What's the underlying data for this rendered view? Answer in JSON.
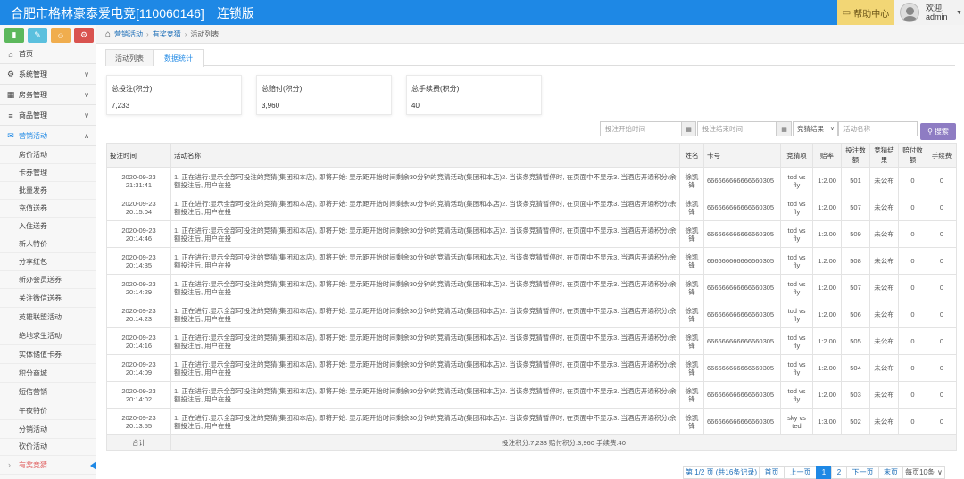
{
  "header": {
    "title": "合肥市格林豪泰爱电竞[110060146]",
    "edition": "连锁版",
    "help": "帮助中心",
    "welcome": "欢迎,",
    "user": "admin"
  },
  "toolbar": {
    "buttons": [
      {
        "icon": "signal-icon",
        "color": "#5cb85c"
      },
      {
        "icon": "pencil-icon",
        "color": "#5bc0de"
      },
      {
        "icon": "users-icon",
        "color": "#f0ad4e"
      },
      {
        "icon": "cogs-icon",
        "color": "#d9534f"
      }
    ]
  },
  "sidebar": {
    "menus": [
      {
        "label": "首页",
        "icon": "home-icon"
      },
      {
        "label": "系统管理",
        "icon": "gear-icon"
      },
      {
        "label": "房务管理",
        "icon": "building-icon"
      },
      {
        "label": "商品管理",
        "icon": "database-icon"
      },
      {
        "label": "营销活动",
        "icon": "gift-icon"
      }
    ],
    "subitems": [
      "房价活动",
      "卡券管理",
      "批量发券",
      "充值送券",
      "入住送券",
      "新人特价",
      "分享红包",
      "新办会员送券",
      "关注微信送券",
      "英雄联盟活动",
      "绝地求生活动",
      "实体储值卡券",
      "积分商城",
      "短信营销",
      "午夜特价",
      "分销活动",
      "砍价活动",
      "有奖竞猜"
    ]
  },
  "breadcrumb": {
    "items": [
      "营销活动",
      "有奖竞猜",
      "活动列表"
    ]
  },
  "tabs": [
    "活动列表",
    "数据统计"
  ],
  "stats": [
    {
      "label": "总投注(积分)",
      "value": "7,233"
    },
    {
      "label": "总赔付(积分)",
      "value": "3,960"
    },
    {
      "label": "总手续费(积分)",
      "value": "40"
    }
  ],
  "filters": {
    "start_placeholder": "投注开始时间",
    "end_placeholder": "投注结束时间",
    "result_select": "竞猜结果",
    "name_placeholder": "活动名称",
    "search_label": "搜索"
  },
  "table": {
    "headers": [
      "投注时间",
      "活动名称",
      "姓名",
      "卡号",
      "竞猜项",
      "赔率",
      "投注数额",
      "竞猜结果",
      "赔付数额",
      "手续费"
    ],
    "rows": [
      {
        "date": "2020-09-23",
        "time": "21:31:41",
        "activity": "1. 正在进行:显示全部可投注的竞猜(集团和本店), 即将开始: 显示距开始时间剩余30分钟的竞猜活动(集团和本店)2. 当该条竞猜暂停时, 在页面中不显示3. 当酒店开通积分/余额投注后, 用户在投",
        "name": "徐凯锋",
        "card": "666666666666660305",
        "item": "tod vs fly",
        "odds": "1:2.00",
        "bet": "501",
        "result": "未公布",
        "payout": "0",
        "fee": "0"
      },
      {
        "date": "2020-09-23",
        "time": "20:15:04",
        "activity": "1. 正在进行:显示全部可投注的竞猜(集团和本店), 即将开始: 显示距开始时间剩余30分钟的竞猜活动(集团和本店)2. 当该条竞猜暂停时, 在页面中不显示3. 当酒店开通积分/余额投注后, 用户在投",
        "name": "徐凯锋",
        "card": "666666666666660305",
        "item": "tod vs fly",
        "odds": "1:2.00",
        "bet": "507",
        "result": "未公布",
        "payout": "0",
        "fee": "0"
      },
      {
        "date": "2020-09-23",
        "time": "20:14:46",
        "activity": "1. 正在进行:显示全部可投注的竞猜(集团和本店), 即将开始: 显示距开始时间剩余30分钟的竞猜活动(集团和本店)2. 当该条竞猜暂停时, 在页面中不显示3. 当酒店开通积分/余额投注后, 用户在投",
        "name": "徐凯锋",
        "card": "666666666666660305",
        "item": "tod vs fly",
        "odds": "1:2.00",
        "bet": "509",
        "result": "未公布",
        "payout": "0",
        "fee": "0"
      },
      {
        "date": "2020-09-23",
        "time": "20:14:35",
        "activity": "1. 正在进行:显示全部可投注的竞猜(集团和本店), 即将开始: 显示距开始时间剩余30分钟的竞猜活动(集团和本店)2. 当该条竞猜暂停时, 在页面中不显示3. 当酒店开通积分/余额投注后, 用户在投",
        "name": "徐凯锋",
        "card": "666666666666660305",
        "item": "tod vs fly",
        "odds": "1:2.00",
        "bet": "508",
        "result": "未公布",
        "payout": "0",
        "fee": "0"
      },
      {
        "date": "2020-09-23",
        "time": "20:14:29",
        "activity": "1. 正在进行:显示全部可投注的竞猜(集团和本店), 即将开始: 显示距开始时间剩余30分钟的竞猜活动(集团和本店)2. 当该条竞猜暂停时, 在页面中不显示3. 当酒店开通积分/余额投注后, 用户在投",
        "name": "徐凯锋",
        "card": "666666666666660305",
        "item": "tod vs fly",
        "odds": "1:2.00",
        "bet": "507",
        "result": "未公布",
        "payout": "0",
        "fee": "0"
      },
      {
        "date": "2020-09-23",
        "time": "20:14:23",
        "activity": "1. 正在进行:显示全部可投注的竞猜(集团和本店), 即将开始: 显示距开始时间剩余30分钟的竞猜活动(集团和本店)2. 当该条竞猜暂停时, 在页面中不显示3. 当酒店开通积分/余额投注后, 用户在投",
        "name": "徐凯锋",
        "card": "666666666666660305",
        "item": "tod vs fly",
        "odds": "1:2.00",
        "bet": "506",
        "result": "未公布",
        "payout": "0",
        "fee": "0"
      },
      {
        "date": "2020-09-23",
        "time": "20:14:16",
        "activity": "1. 正在进行:显示全部可投注的竞猜(集团和本店), 即将开始: 显示距开始时间剩余30分钟的竞猜活动(集团和本店)2. 当该条竞猜暂停时, 在页面中不显示3. 当酒店开通积分/余额投注后, 用户在投",
        "name": "徐凯锋",
        "card": "666666666666660305",
        "item": "tod vs fly",
        "odds": "1:2.00",
        "bet": "505",
        "result": "未公布",
        "payout": "0",
        "fee": "0"
      },
      {
        "date": "2020-09-23",
        "time": "20:14:09",
        "activity": "1. 正在进行:显示全部可投注的竞猜(集团和本店), 即将开始: 显示距开始时间剩余30分钟的竞猜活动(集团和本店)2. 当该条竞猜暂停时, 在页面中不显示3. 当酒店开通积分/余额投注后, 用户在投",
        "name": "徐凯锋",
        "card": "666666666666660305",
        "item": "tod vs fly",
        "odds": "1:2.00",
        "bet": "504",
        "result": "未公布",
        "payout": "0",
        "fee": "0"
      },
      {
        "date": "2020-09-23",
        "time": "20:14:02",
        "activity": "1. 正在进行:显示全部可投注的竞猜(集团和本店), 即将开始: 显示距开始时间剩余30分钟的竞猜活动(集团和本店)2. 当该条竞猜暂停时, 在页面中不显示3. 当酒店开通积分/余额投注后, 用户在投",
        "name": "徐凯锋",
        "card": "666666666666660305",
        "item": "tod vs fly",
        "odds": "1:2.00",
        "bet": "503",
        "result": "未公布",
        "payout": "0",
        "fee": "0"
      },
      {
        "date": "2020-09-23",
        "time": "20:13:55",
        "activity": "1. 正在进行:显示全部可投注的竞猜(集团和本店), 即将开始: 显示距开始时间剩余30分钟的竞猜活动(集团和本店)2. 当该条竞猜暂停时, 在页面中不显示3. 当酒店开通积分/余额投注后, 用户在投",
        "name": "徐凯锋",
        "card": "666666666666660305",
        "item": "sky vs ted",
        "odds": "1:3.00",
        "bet": "502",
        "result": "未公布",
        "payout": "0",
        "fee": "0"
      }
    ],
    "summary_label": "合计",
    "summary_text": "投注积分:7,233  赔付积分:3,960  手续费:40"
  },
  "pagination": {
    "info": "第 1/2 页 (共16条记录)",
    "first": "首页",
    "prev": "上一页",
    "pages": [
      "1",
      "2"
    ],
    "next": "下一页",
    "last": "末页",
    "page_size": "每页10条"
  }
}
